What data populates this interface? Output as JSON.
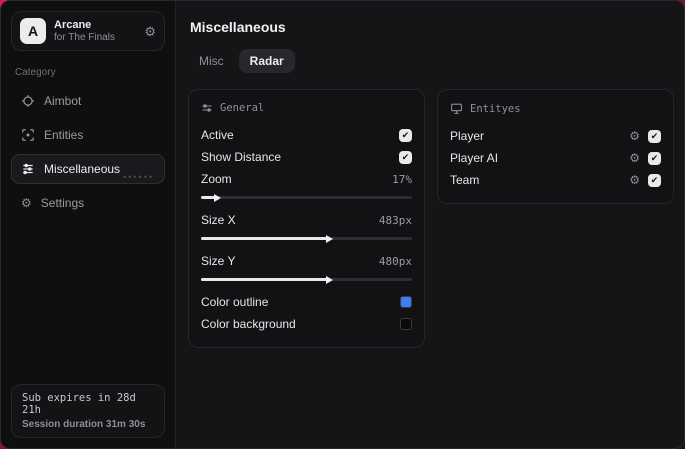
{
  "window_title": "Arcane",
  "profile": {
    "name": "Arcane",
    "subtitle": "for The Finals",
    "gear_icon": "gear-icon"
  },
  "sidebar": {
    "category_label": "Category",
    "items": [
      {
        "label": "Aimbot",
        "icon": "crosshair-icon",
        "selected": false
      },
      {
        "label": "Entities",
        "icon": "scan-icon",
        "selected": false
      },
      {
        "label": "Miscellaneous",
        "icon": "sliders-icon",
        "selected": true
      },
      {
        "label": "Settings",
        "icon": "gear-icon",
        "selected": false
      }
    ],
    "sub_expires": "Sub expires in 28d 21h",
    "session_duration": "Session duration 31m 30s"
  },
  "main": {
    "title": "Miscellaneous",
    "tabs": [
      {
        "label": "Misc",
        "active": false
      },
      {
        "label": "Radar",
        "active": true
      }
    ]
  },
  "general_card": {
    "title": "General",
    "icon": "sliders-icon",
    "active": {
      "label": "Active",
      "checked": true,
      "check_glyph": "✔"
    },
    "show_distance": {
      "label": "Show Distance",
      "checked": true,
      "check_glyph": "✔"
    },
    "zoom": {
      "label": "Zoom",
      "value": "17%",
      "percent": 7
    },
    "size_x": {
      "label": "Size X",
      "value": "483px",
      "percent": 60
    },
    "size_y": {
      "label": "Size Y",
      "value": "480px",
      "percent": 60
    },
    "color_outline": {
      "label": "Color outline"
    },
    "color_background": {
      "label": "Color background"
    }
  },
  "entities_card": {
    "title": "Entityes",
    "icon": "monitor-icon",
    "rows": [
      {
        "label": "Player",
        "checked": true,
        "check_glyph": "✔",
        "gear_glyph": "⚙"
      },
      {
        "label": "Player AI",
        "checked": true,
        "check_glyph": "✔",
        "gear_glyph": "⚙"
      },
      {
        "label": "Team",
        "checked": true,
        "check_glyph": "✔",
        "gear_glyph": "⚙"
      }
    ]
  },
  "colors": {
    "accent_background": "#cf2150",
    "outline_swatch": "#3f7df6",
    "background_swatch": "#0a0a0a",
    "checkbox": "#e9e9ec"
  },
  "glyphs": {
    "gear": "⚙",
    "dots": "••••••"
  }
}
